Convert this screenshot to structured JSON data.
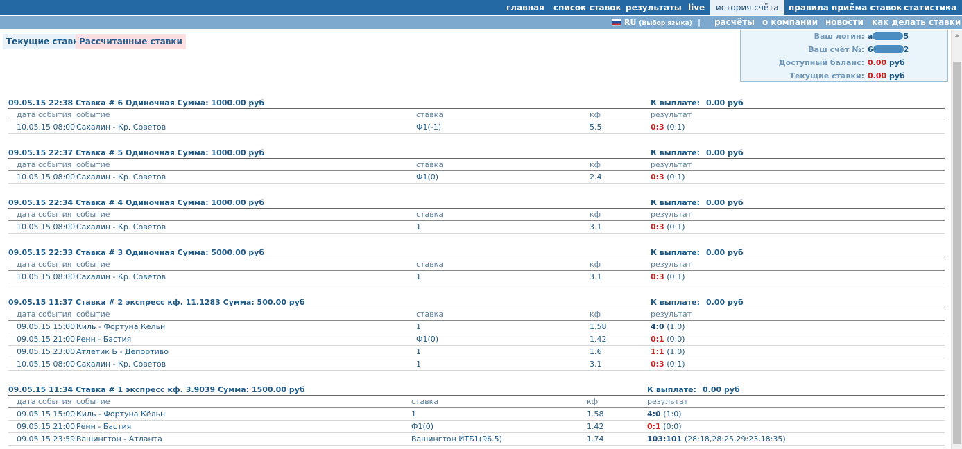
{
  "topnav": [
    "главная",
    "список ставок",
    "результаты",
    "live",
    "история счёта",
    "правила приёма ставок",
    "статистика"
  ],
  "subnav": {
    "lang": "RU",
    "lang_hint": "(Выбор языка)",
    "sep": "|",
    "links": [
      "расчёты",
      "о компании",
      "новости",
      "как делать ставки"
    ]
  },
  "tabs": {
    "current": "Текущие ставки",
    "settled": "Рассчитанные ставки"
  },
  "account": {
    "login_label": "Ваш логин:",
    "login_a": "a",
    "login_b": "5",
    "acct_label": "Ваш счёт №:",
    "acct_a": "6",
    "acct_b": "2",
    "balance_label": "Доступный баланс:",
    "balance_value": "0.00",
    "balance_unit": "руб",
    "cur_label": "Текущие ставки:",
    "cur_value": "0.00",
    "cur_unit": "руб"
  },
  "cols": {
    "date": "дата события",
    "event": "событие",
    "bet": "ставка",
    "kf": "кф",
    "result": "результат"
  },
  "payout_label": "К выплате:",
  "bets": [
    {
      "title": "09.05.15 22:38  Ставка # 6   Одиночная  Сумма: 1000.00 руб",
      "payout": "0.00 руб",
      "rows": [
        {
          "date": "10.05.15 08:00",
          "event": "Сахалин - Кр. Советов",
          "bet": "Ф1(-1)",
          "kf": "5.5",
          "score": "0:3",
          "detail": "(0:1)",
          "color": "red"
        }
      ]
    },
    {
      "title": "09.05.15 22:37  Ставка # 5   Одиночная  Сумма: 1000.00 руб",
      "payout": "0.00 руб",
      "rows": [
        {
          "date": "10.05.15 08:00",
          "event": "Сахалин - Кр. Советов",
          "bet": "Ф1(0)",
          "kf": "2.4",
          "score": "0:3",
          "detail": "(0:1)",
          "color": "red"
        }
      ]
    },
    {
      "title": "09.05.15 22:34  Ставка # 4   Одиночная  Сумма: 1000.00 руб",
      "payout": "0.00 руб",
      "rows": [
        {
          "date": "10.05.15 08:00",
          "event": "Сахалин - Кр. Советов",
          "bet": "1",
          "kf": "3.1",
          "score": "0:3",
          "detail": "(0:1)",
          "color": "red"
        }
      ]
    },
    {
      "title": "09.05.15 22:33  Ставка # 3   Одиночная  Сумма: 5000.00 руб",
      "payout": "0.00 руб",
      "rows": [
        {
          "date": "10.05.15 08:00",
          "event": "Сахалин - Кр. Советов",
          "bet": "1",
          "kf": "3.1",
          "score": "0:3",
          "detail": "(0:1)",
          "color": "red"
        }
      ]
    },
    {
      "title": "09.05.15 11:37  Ставка # 2   экспресс  кф. 11.1283  Сумма: 500.00 руб",
      "payout": "0.00 руб",
      "rows": [
        {
          "date": "09.05.15 15:00",
          "event": "Киль - Фортуна Кёльн",
          "bet": "1",
          "kf": "1.58",
          "score": "4:0",
          "detail": "(1:0)",
          "color": "blue"
        },
        {
          "date": "09.05.15 21:00",
          "event": "Ренн - Бастия",
          "bet": "Ф1(0)",
          "kf": "1.42",
          "score": "0:1",
          "detail": "(0:0)",
          "color": "red"
        },
        {
          "date": "09.05.15 23:00",
          "event": "Атлетик Б - Депортиво",
          "bet": "1",
          "kf": "1.6",
          "score": "1:1",
          "detail": "(1:0)",
          "color": "red"
        },
        {
          "date": "10.05.15 08:00",
          "event": "Сахалин - Кр. Советов",
          "bet": "1",
          "kf": "3.1",
          "score": "0:3",
          "detail": "(0:1)",
          "color": "red"
        }
      ]
    },
    {
      "title": "09.05.15 11:34  Ставка # 1   экспресс  кф. 3.9039  Сумма: 1500.00 руб",
      "payout": "0.00 руб",
      "rows": [
        {
          "date": "09.05.15 15:00",
          "event": "Киль - Фортуна Кёльн",
          "bet": "1",
          "kf": "1.58",
          "score": "4:0",
          "detail": "(1:0)",
          "color": "blue"
        },
        {
          "date": "09.05.15 21:00",
          "event": "Ренн - Бастия",
          "bet": "Ф1(0)",
          "kf": "1.42",
          "score": "0:1",
          "detail": "(0:0)",
          "color": "red"
        },
        {
          "date": "09.05.15 23:59",
          "event": "Вашингтон - Атланта",
          "bet": "Вашингтон ИТБ1(96.5)",
          "kf": "1.74",
          "score": "103:101",
          "detail": "(28:18,28:25,29:23,18:35)",
          "color": "blue"
        }
      ]
    }
  ]
}
